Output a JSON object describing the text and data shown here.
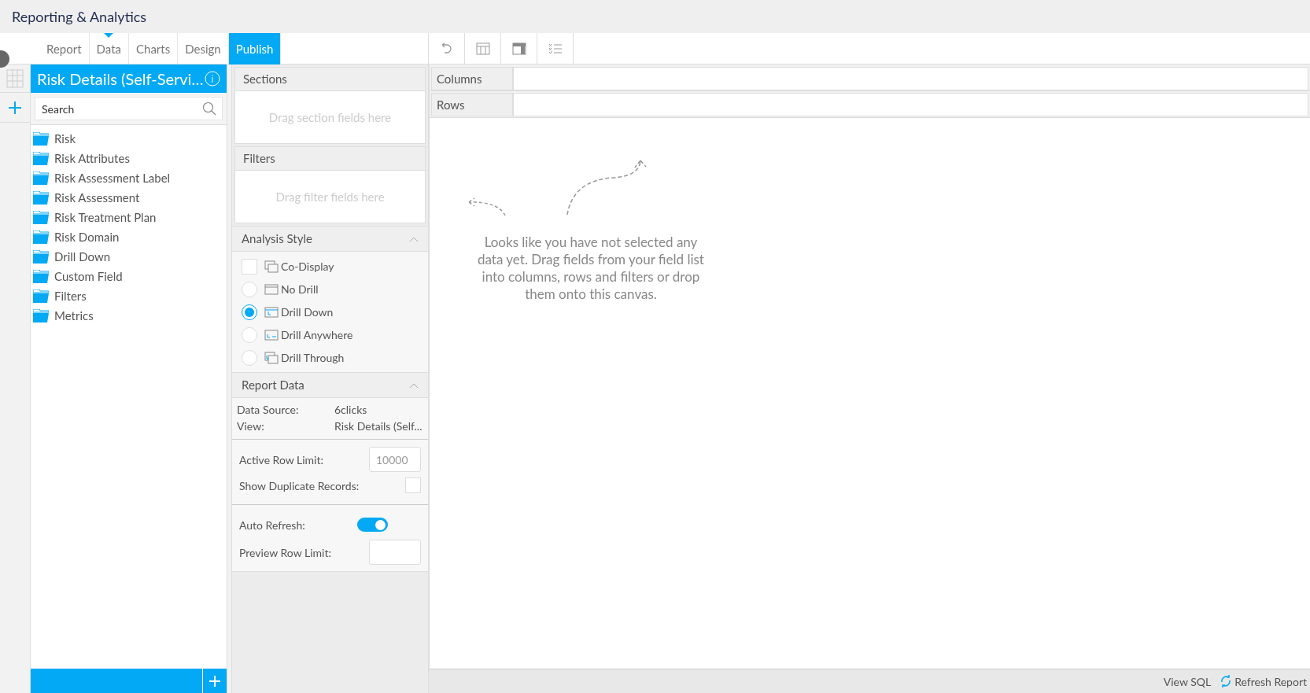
{
  "app_title": "Reporting & Analytics",
  "tabs": [
    {
      "label": "Report",
      "selected": false,
      "indicator": false
    },
    {
      "label": "Data",
      "selected": false,
      "indicator": true
    },
    {
      "label": "Charts",
      "selected": false,
      "indicator": false
    },
    {
      "label": "Design",
      "selected": false,
      "indicator": false
    },
    {
      "label": "Publish",
      "selected": true,
      "indicator": false
    }
  ],
  "field_list": {
    "title": "Risk Details (Self-Servi…",
    "search": {
      "placeholder": "Search"
    },
    "folders": [
      "Risk",
      "Risk Attributes",
      "Risk Assessment Label",
      "Risk Assessment",
      "Risk Treatment Plan",
      "Risk Domain",
      "Drill Down",
      "Custom Field",
      "Filters",
      "Metrics"
    ]
  },
  "sections": {
    "title": "Sections",
    "hint": "Drag section fields here"
  },
  "filters": {
    "title": "Filters",
    "hint": "Drag filter fields here"
  },
  "analysis_style": {
    "title": "Analysis Style",
    "expanded": true,
    "options": [
      {
        "kind": "checkbox",
        "label": "Co-Display",
        "checked": false
      },
      {
        "kind": "radio",
        "label": "No Drill",
        "selected": false
      },
      {
        "kind": "radio",
        "label": "Drill Down",
        "selected": true
      },
      {
        "kind": "radio",
        "label": "Drill Anywhere",
        "selected": false
      },
      {
        "kind": "radio",
        "label": "Drill Through",
        "selected": false
      }
    ]
  },
  "report_data": {
    "title": "Report Data",
    "expanded": true,
    "info": [
      {
        "label": "Data Source:",
        "value": "6clicks"
      },
      {
        "label": "View:",
        "value": "Risk Details (Self..."
      }
    ],
    "active_row_limit": {
      "label": "Active Row Limit:",
      "placeholder": "10000"
    },
    "show_duplicates": {
      "label": "Show Duplicate Records:",
      "checked": false
    },
    "auto_refresh": {
      "label": "Auto Refresh:",
      "on": true
    },
    "preview_row_limit": {
      "label": "Preview Row Limit:"
    }
  },
  "columns_label": "Columns",
  "rows_label": "Rows",
  "empty_message": "Looks like you have not selected any data yet. Drag fields from your field list into columns, rows and filters or drop them onto this canvas.",
  "footer": {
    "view_sql": "View SQL",
    "refresh": "Refresh Report"
  }
}
